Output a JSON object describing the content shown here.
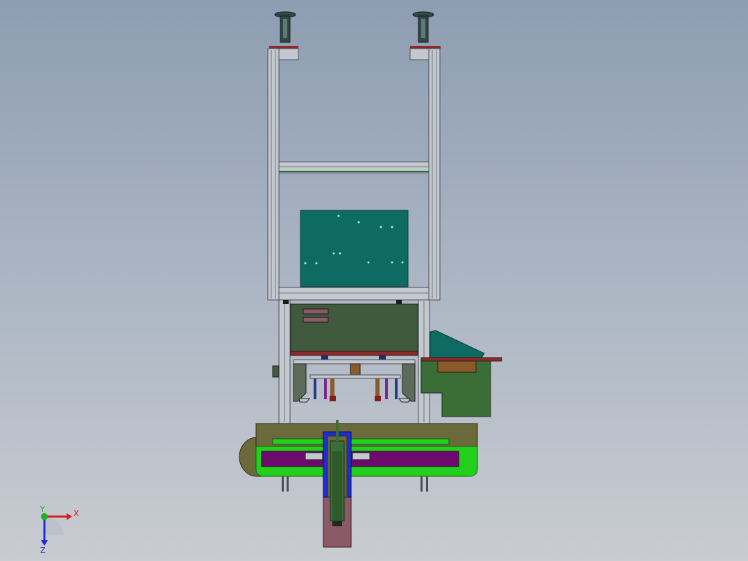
{
  "viewport": {
    "background_top": "#8e9db2",
    "background_bottom": "#c9ccd1"
  },
  "colors": {
    "frame_aluminum": "#c4c9d0",
    "frame_edge": "#4a4f57",
    "teal_panel": "#0d6b63",
    "olive_housing": "#3f5a3c",
    "green_housing": "#3b6e36",
    "bright_green": "#22d11b",
    "purple_slot": "#6d0b6d",
    "olive_plate": "#6b6a3a",
    "mauve_rail": "#8a5a68",
    "red_plate": "#8b2a2a"
  },
  "triad": {
    "x_label": "X",
    "y_label": "Y",
    "z_label": "Z",
    "x_color": "#d61b1b",
    "y_color": "#1fae26",
    "z_color": "#1c2fd6"
  }
}
